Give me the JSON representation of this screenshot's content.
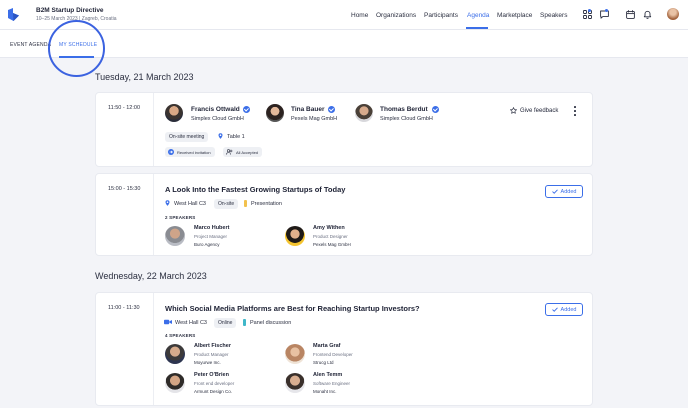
{
  "header": {
    "event_title": "B2M Startup Directive",
    "event_subtitle": "10–25 March 2023 | Zagreb, Croatia",
    "nav": [
      "Home",
      "Organizations",
      "Participants",
      "Agenda",
      "Marketplace",
      "Speakers"
    ],
    "active_nav": "Agenda",
    "icons": [
      "grid-icon",
      "chat-icon",
      "calendar-icon",
      "bell-icon"
    ],
    "accent_color": "#3b6ee8"
  },
  "subtabs": {
    "event_agenda": "EVENT AGENDA",
    "my_schedule": "MY SCHEDULE",
    "active": "MY SCHEDULE"
  },
  "days": [
    {
      "date": "Tuesday, 21 March 2023",
      "sessions": [
        {
          "time": "11:50 - 12:00",
          "participants": [
            {
              "name": "Francis Ottwald",
              "company": "Simplex Cloud GmbH"
            },
            {
              "name": "Tina Bauer",
              "company": "Pexels Mag GmbH"
            },
            {
              "name": "Thomas Berdut",
              "company": "Simplex Cloud GmbH"
            }
          ],
          "meeting_type": "On-site meeting",
          "table": "Table 1",
          "status_1": "Received invitation",
          "status_2": "All Accepted",
          "feedback_label": "Give feedback"
        },
        {
          "time": "15:00 - 15:30",
          "title": "A Look Into the Fastest Growing Startups of Today",
          "location": "West Hall C3",
          "mode": "On-site",
          "format": "Presentation",
          "format_color": "#f2c14e",
          "speakers_heading": "2 SPEAKERS",
          "speakers": [
            {
              "name": "Marco Hubert",
              "role": "Project Manager",
              "company": "Buro Agency"
            },
            {
              "name": "Amy Withen",
              "role": "Product Designer",
              "company": "Pexels Mag GmbH"
            }
          ],
          "added_label": "Added"
        }
      ]
    },
    {
      "date": "Wednesday, 22 March 2023",
      "sessions": [
        {
          "time": "11:00 - 11:30",
          "title": "Which Social Media Platforms are Best for Reaching Startup Investors?",
          "location": "West Hall C3",
          "mode": "Online",
          "format": "Panel discussion",
          "format_color": "#3fb7c9",
          "speakers_heading": "4 SPEAKERS",
          "speakers": [
            {
              "name": "Albert Fischer",
              "role": "Product Manager",
              "company": "Moyurwe Inc."
            },
            {
              "name": "Marta Graf",
              "role": "Frontend Developer",
              "company": "Strucg Ltd"
            },
            {
              "name": "Peter O'Brien",
              "role": "Front end developer",
              "company": "Armunt Design Co."
            },
            {
              "name": "Alen Temm",
              "role": "Software Engineer",
              "company": "Monaht Inc."
            }
          ],
          "added_label": "Added"
        }
      ]
    }
  ]
}
